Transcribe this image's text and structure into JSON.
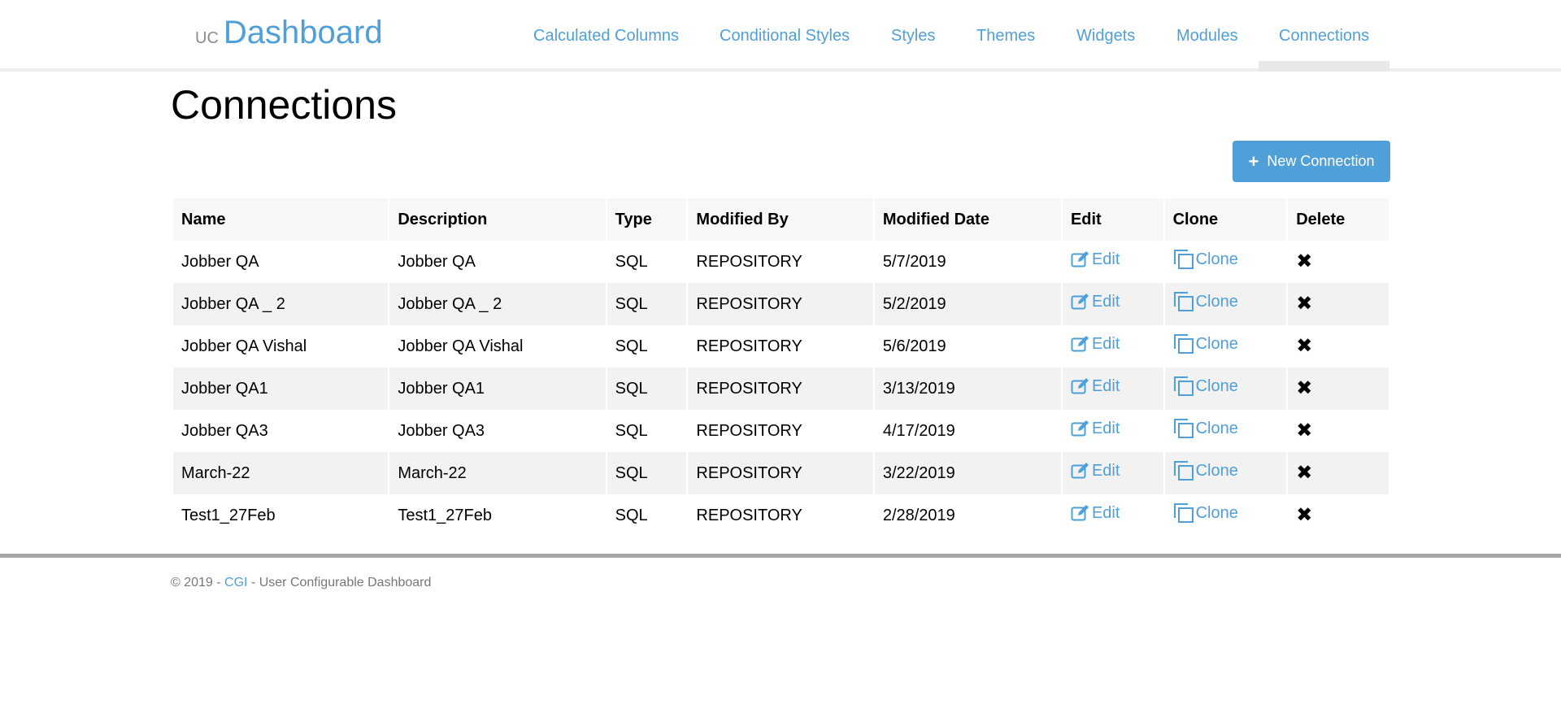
{
  "brand": {
    "prefix": "UC",
    "name": "Dashboard"
  },
  "nav": {
    "items": [
      {
        "label": "Calculated Columns"
      },
      {
        "label": "Conditional Styles"
      },
      {
        "label": "Styles"
      },
      {
        "label": "Themes"
      },
      {
        "label": "Widgets"
      },
      {
        "label": "Modules"
      },
      {
        "label": "Connections"
      }
    ],
    "active": "Connections"
  },
  "page": {
    "title": "Connections",
    "new_button_label": "New Connection"
  },
  "table": {
    "headers": [
      "Name",
      "Description",
      "Type",
      "Modified By",
      "Modified Date",
      "Edit",
      "Clone",
      "Delete"
    ],
    "edit_label": "Edit",
    "clone_label": "Clone",
    "rows": [
      {
        "name": "Jobber QA",
        "description": "Jobber QA",
        "type": "SQL",
        "modified_by": "REPOSITORY",
        "modified_date": "5/7/2019"
      },
      {
        "name": "Jobber QA _ 2",
        "description": "Jobber QA _ 2",
        "type": "SQL",
        "modified_by": "REPOSITORY",
        "modified_date": "5/2/2019"
      },
      {
        "name": "Jobber QA Vishal",
        "description": "Jobber QA Vishal",
        "type": "SQL",
        "modified_by": "REPOSITORY",
        "modified_date": "5/6/2019"
      },
      {
        "name": "Jobber QA1",
        "description": "Jobber QA1",
        "type": "SQL",
        "modified_by": "REPOSITORY",
        "modified_date": "3/13/2019"
      },
      {
        "name": "Jobber QA3",
        "description": "Jobber QA3",
        "type": "SQL",
        "modified_by": "REPOSITORY",
        "modified_date": "4/17/2019"
      },
      {
        "name": "March-22",
        "description": "March-22",
        "type": "SQL",
        "modified_by": "REPOSITORY",
        "modified_date": "3/22/2019"
      },
      {
        "name": "Test1_27Feb",
        "description": "Test1_27Feb",
        "type": "SQL",
        "modified_by": "REPOSITORY",
        "modified_date": "2/28/2019"
      }
    ]
  },
  "footer": {
    "prefix": "© 2019 - ",
    "link": "CGI",
    "suffix": " - User Configurable Dashboard"
  },
  "colors": {
    "accent": "#4f9fd9",
    "footer_rule": "#a6a6a6",
    "row_stripe": "#f2f2f2"
  }
}
